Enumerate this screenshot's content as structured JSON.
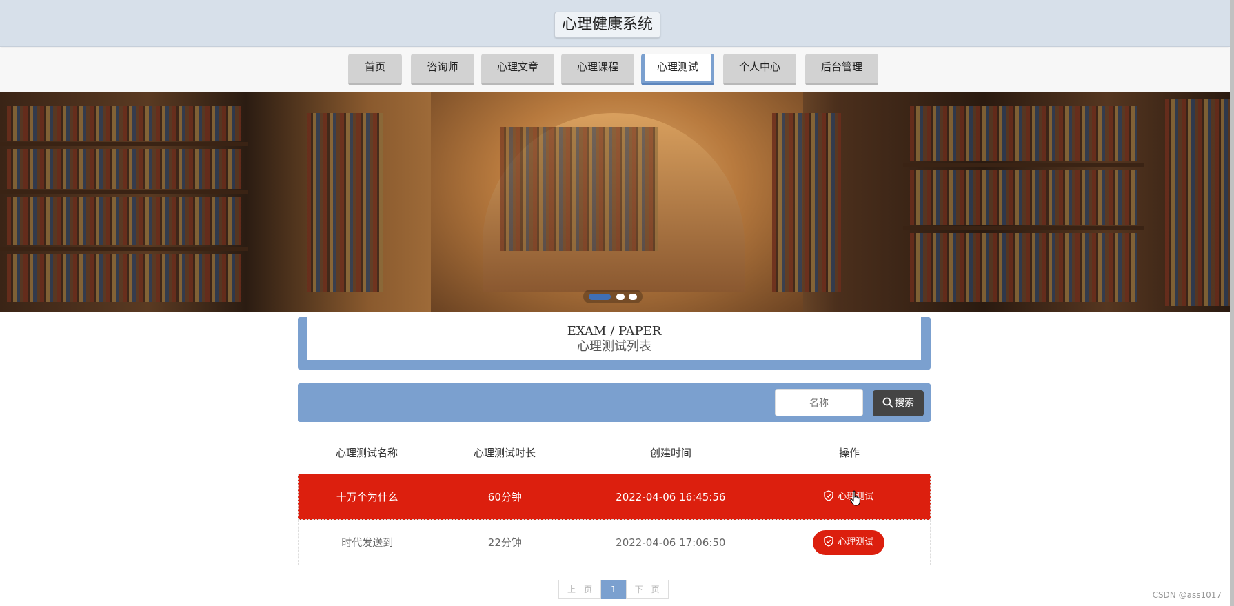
{
  "site": {
    "title": "心理健康系统"
  },
  "nav": {
    "items": [
      {
        "label": "首页"
      },
      {
        "label": "咨询师"
      },
      {
        "label": "心理文章"
      },
      {
        "label": "心理课程"
      },
      {
        "label": "心理测试"
      },
      {
        "label": "个人中心"
      },
      {
        "label": "后台管理"
      }
    ],
    "active": "心理测试"
  },
  "banner": {
    "slides": 3,
    "current_slide": 1
  },
  "section": {
    "title_en": "EXAM / PAPER",
    "title_cn": "心理测试列表"
  },
  "search": {
    "placeholder": "名称",
    "button_label": "搜索"
  },
  "table": {
    "headers": [
      "心理测试名称",
      "心理测试时长",
      "创建时间",
      "操作"
    ],
    "rows": [
      {
        "name": "十万个为什么",
        "duration": "60分钟",
        "created": "2022-04-06 16:45:56",
        "action": "心理测试"
      },
      {
        "name": "时代发送到",
        "duration": "22分钟",
        "created": "2022-04-06 17:06:50",
        "action": "心理测试"
      }
    ]
  },
  "pagination": {
    "prev": "上一页",
    "current": "1",
    "next": "下一页"
  },
  "watermark": "CSDN @ass1017",
  "colors": {
    "accent": "#7ba0cf",
    "danger": "#dc1f0e",
    "header_bg": "#d7e0ea"
  }
}
